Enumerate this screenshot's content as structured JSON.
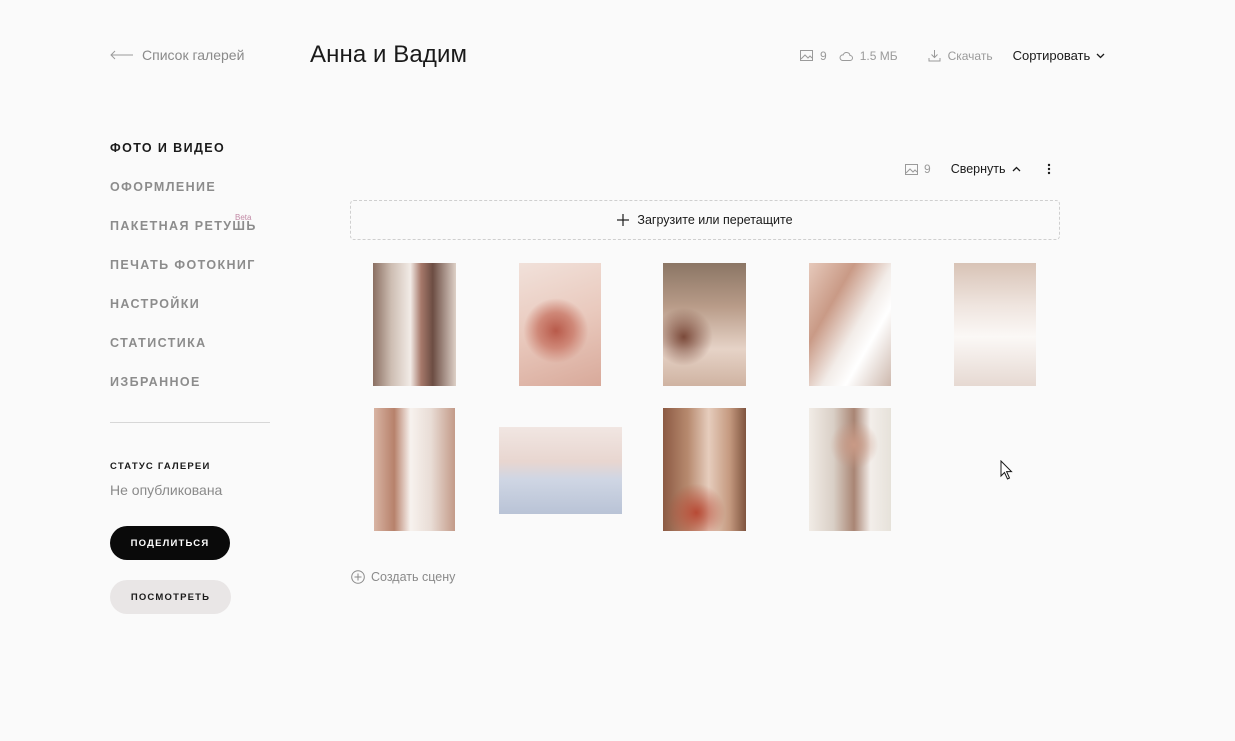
{
  "header": {
    "back_label": "Список галерей",
    "title": "Анна и Вадим",
    "photo_count": "9",
    "size": "1.5 МБ",
    "download_label": "Скачать",
    "sort_label": "Сортировать"
  },
  "sidebar": {
    "items": [
      {
        "label": "ФОТО И ВИДЕО",
        "active": true
      },
      {
        "label": "ОФОРМЛЕНИЕ"
      },
      {
        "label": "ПАКЕТНАЯ РЕТУШЬ",
        "badge": "Beta"
      },
      {
        "label": "ПЕЧАТЬ ФОТОКНИГ"
      },
      {
        "label": "НАСТРОЙКИ"
      },
      {
        "label": "СТАТИСТИКА"
      },
      {
        "label": "ИЗБРАННОЕ"
      }
    ],
    "status_label": "СТАТУС ГАЛЕРЕИ",
    "status_value": "Не опубликована",
    "share_button": "ПОДЕЛИТЬСЯ",
    "view_button": "ПОСМОТРЕТЬ"
  },
  "scene": {
    "photo_count": "9",
    "collapse_label": "Свернуть",
    "upload_label": "Загрузите или перетащите",
    "create_scene_label": "Создать сцену"
  },
  "colors": {
    "background": "#fafafa",
    "text": "#1a1a1a",
    "muted": "#8a8a8a",
    "primary_button": "#0a0a0a",
    "secondary_button": "#e9e6e6",
    "beta": "#c28aa6"
  }
}
